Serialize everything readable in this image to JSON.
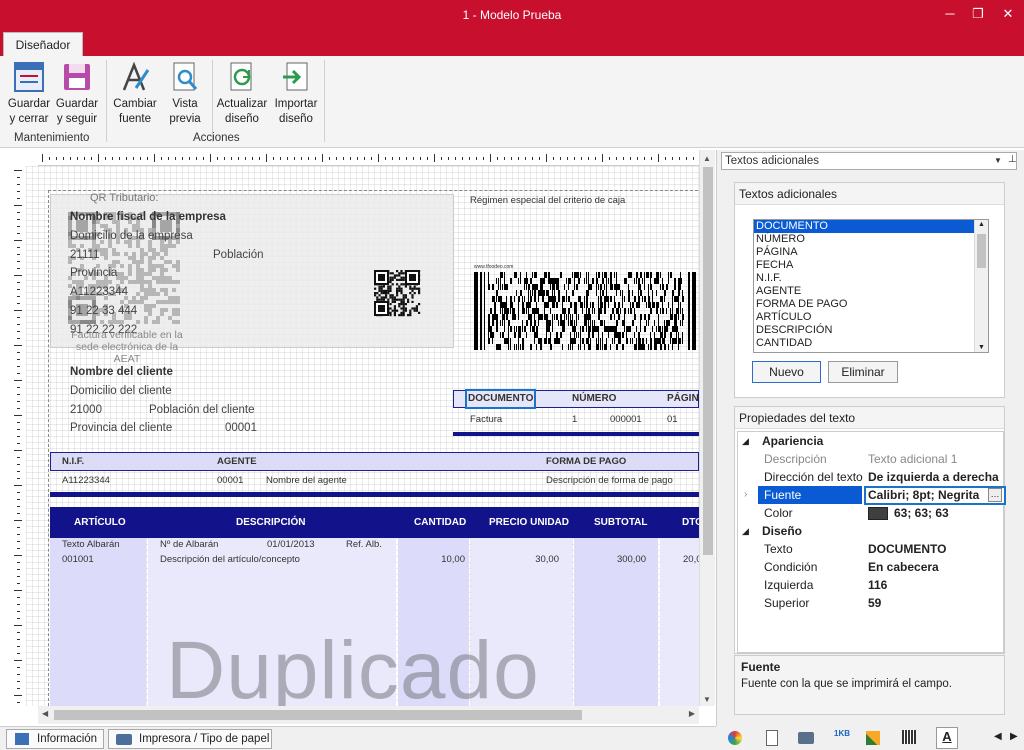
{
  "window": {
    "title": "1 - Modelo Prueba",
    "minimize": "─",
    "restore": "❐",
    "close": "✕"
  },
  "tabs": {
    "active": "Diseñador"
  },
  "ribbon": {
    "buttons": [
      {
        "line1": "Guardar",
        "line2": "y cerrar"
      },
      {
        "line1": "Guardar",
        "line2": "y seguir"
      },
      {
        "line1": "Cambiar",
        "line2": "fuente"
      },
      {
        "line1": "Vista",
        "line2": "previa"
      },
      {
        "line1": "Actualizar",
        "line2": "diseño"
      },
      {
        "line1": "Importar",
        "line2": "diseño"
      }
    ],
    "groups": [
      "Mantenimiento",
      "Acciones"
    ]
  },
  "design": {
    "qr_label": "QR Tributario:",
    "company": {
      "name": "Nombre fiscal de la empresa",
      "address": "Domicilio de la empresa",
      "postal": "21111",
      "city": "Población",
      "province": "Provincia",
      "nif": "A11223344",
      "phone": "91 22 33 444",
      "phone2": "91 22 22 222"
    },
    "verifiable": "Factura verificable en la sede electrónica de la AEAT",
    "regimen": "Régimen especial del criterio de caja",
    "barcode_url": "www.tfoodeo.com",
    "client": {
      "name": "Nombre del cliente",
      "address": "Domicilio del cliente",
      "postal": "21000",
      "city": "Población del cliente",
      "province": "Provincia del cliente",
      "code": "00001"
    },
    "doc_headers": [
      "DOCUMENTO",
      "NÚMERO",
      "PÁGINA"
    ],
    "doc_values": [
      "Factura",
      "1",
      "000001",
      "01"
    ],
    "nif_headers": [
      "N.I.F.",
      "AGENTE",
      "FORMA DE PAGO"
    ],
    "nif_values": [
      "A11223344",
      "00001",
      "Nombre del agente",
      "Descripción de forma de pago"
    ],
    "table_headers": [
      "ARTÍCULO",
      "DESCRIPCIÓN",
      "CANTIDAD",
      "PRECIO UNIDAD",
      "SUBTOTAL",
      "DTO."
    ],
    "row": {
      "albaran": "Texto Albarán",
      "num_albaran": "Nº de Albarán",
      "date": "01/01/2013",
      "ref": "Ref. Alb.",
      "article": "001001",
      "description": "Descripción del artículo/concepto",
      "qty": "10,00",
      "price": "30,00",
      "subtotal": "300,00",
      "dto": "20,0"
    },
    "watermark": "Duplicado"
  },
  "panel": {
    "dropdown": "Textos adicionales",
    "section1": "Textos adicionales",
    "list": [
      "DOCUMENTO",
      "NÚMERO",
      "PÁGINA",
      "FECHA",
      "N.I.F.",
      "AGENTE",
      "FORMA DE PAGO",
      "ARTÍCULO",
      "DESCRIPCIÓN",
      "CANTIDAD"
    ],
    "nuevo": "Nuevo",
    "eliminar": "Eliminar",
    "section2": "Propiedades del texto",
    "cat1": "Apariencia",
    "props1": [
      {
        "k": "Descripción",
        "v": "Texto adicional 1"
      },
      {
        "k": "Dirección del texto",
        "v": "De izquierda a derecha"
      },
      {
        "k": "Fuente",
        "v": "Calibri; 8pt; Negrita"
      },
      {
        "k": "Color",
        "v": "63; 63; 63"
      }
    ],
    "cat2": "Diseño",
    "props2": [
      {
        "k": "Texto",
        "v": "DOCUMENTO"
      },
      {
        "k": "Condición",
        "v": "En cabecera"
      },
      {
        "k": "Izquierda",
        "v": "116"
      },
      {
        "k": "Superior",
        "v": "59"
      }
    ],
    "help_title": "Fuente",
    "help_text": "Fuente con la que se imprimirá el campo."
  },
  "status": {
    "info": "Información",
    "printer": "Impresora / Tipo de papel"
  }
}
